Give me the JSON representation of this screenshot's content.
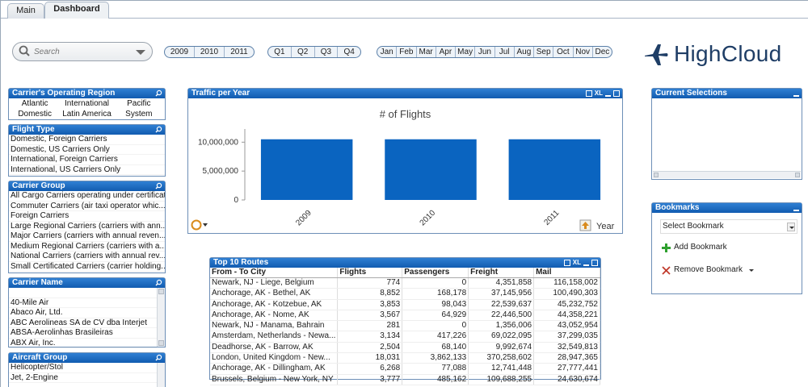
{
  "tabs": [
    {
      "label": "Main"
    },
    {
      "label": "Dashboard"
    }
  ],
  "search": {
    "placeholder": "Search"
  },
  "years": [
    "2009",
    "2010",
    "2011"
  ],
  "quarters": [
    "Q1",
    "Q2",
    "Q3",
    "Q4"
  ],
  "months": [
    "Jan",
    "Feb",
    "Mar",
    "Apr",
    "May",
    "Jun",
    "Jul",
    "Aug",
    "Sep",
    "Oct",
    "Nov",
    "Dec"
  ],
  "logo": {
    "text1": "High",
    "text2": "Cloud",
    "color": "#1f3e66"
  },
  "region_box": {
    "title": "Carrier's Operating Region",
    "items": [
      "Atlantic",
      "International",
      "Pacific",
      "Domestic",
      "Latin America",
      "System"
    ]
  },
  "flight_type_box": {
    "title": "Flight Type",
    "items": [
      "Domestic, Foreign Carriers",
      "Domestic, US Carriers Only",
      "International, Foreign Carriers",
      "International, US Carriers Only"
    ]
  },
  "carrier_group_box": {
    "title": "Carrier Group",
    "items": [
      "All Cargo Carriers operating under certificat...",
      "Commuter Carriers (air taxi operator whic...",
      "Foreign Carriers",
      "Large Regional Carriers (carriers with ann...",
      "Major Carriers (carriers with annual reven...",
      "Medium Regional Carriers (carriers with a...",
      "National Carriers (carriers with annual rev...",
      "Small Certificated Carriers (carrier holding..."
    ]
  },
  "carrier_name_box": {
    "title": "Carrier Name",
    "items": [
      "",
      "40-Mile Air",
      "Abaco Air, Ltd.",
      "ABC Aerolineas SA de CV dba Interjet",
      "ABSA-Aerolinhas Brasileiras",
      "ABX Air, Inc."
    ]
  },
  "aircraft_group_box": {
    "title": "Aircraft Group",
    "items": [
      "Helicopter/Stol",
      "Jet, 2-Engine"
    ]
  },
  "traffic_panel": {
    "title": "Traffic per Year",
    "icon_xl": "XL",
    "axis_label": "Year",
    "bar_color": "#0a64c0"
  },
  "chart_data": {
    "type": "bar",
    "title": "# of Flights",
    "categories": [
      "2009",
      "2010",
      "2011"
    ],
    "values": [
      10500000,
      10500000,
      10500000
    ],
    "xlabel": "Year",
    "ylabel": "",
    "ylim": [
      0,
      12000000
    ],
    "yticks": [
      "0",
      "5,000,000",
      "10,000,000"
    ],
    "ytick_values": [
      0,
      5000000,
      10000000
    ],
    "grid": false
  },
  "routes_panel": {
    "title": "Top 10 Routes",
    "icon_xl": "XL",
    "columns": [
      "From - To City",
      "Flights",
      "Passengers",
      "Freight",
      "Mail"
    ],
    "rows": [
      [
        "Newark, NJ - Liege, Belgium",
        "774",
        "0",
        "4,351,858",
        "116,158,002"
      ],
      [
        "Anchorage, AK - Bethel, AK",
        "8,852",
        "168,178",
        "37,145,956",
        "100,490,303"
      ],
      [
        "Anchorage, AK - Kotzebue, AK",
        "3,853",
        "98,043",
        "22,539,637",
        "45,232,752"
      ],
      [
        "Anchorage, AK - Nome, AK",
        "3,567",
        "64,929",
        "22,446,500",
        "44,358,221"
      ],
      [
        "Newark, NJ - Manama, Bahrain",
        "281",
        "0",
        "1,356,006",
        "43,052,954"
      ],
      [
        "Amsterdam, Netherlands - Newa...",
        "3,134",
        "417,226",
        "69,022,095",
        "37,299,035"
      ],
      [
        "Deadhorse, AK - Barrow, AK",
        "2,504",
        "68,140",
        "9,992,674",
        "32,549,813"
      ],
      [
        "London, United Kingdom - New...",
        "18,031",
        "3,862,133",
        "370,258,602",
        "28,947,365"
      ],
      [
        "Anchorage, AK - Dillingham, AK",
        "6,268",
        "77,088",
        "12,741,448",
        "27,777,441"
      ],
      [
        "Brussels, Belgium - New York, NY",
        "3,777",
        "485,162",
        "109,688,255",
        "24,630,674"
      ]
    ]
  },
  "current_selections": {
    "title": "Current Selections"
  },
  "bookmarks": {
    "title": "Bookmarks",
    "select_label": "Select Bookmark",
    "add_label": "Add Bookmark",
    "remove_label": "Remove Bookmark"
  }
}
